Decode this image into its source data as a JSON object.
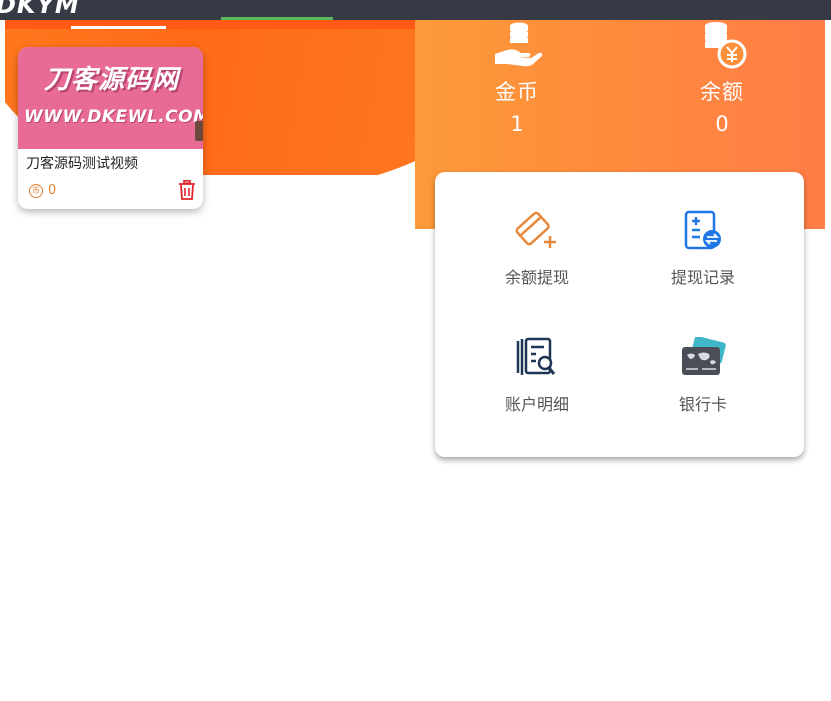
{
  "top_bar": {
    "logo_fragment": "DKYM"
  },
  "video_card": {
    "thumbnail_line1": "刀客源码网",
    "thumbnail_line2": "WWW.DKEWL.COM",
    "title": "刀客源码测试视频",
    "coin_symbol": "币",
    "coin_count": "0"
  },
  "wallet": {
    "gold": {
      "label": "金币",
      "value": "1",
      "icon": "coins-hand-icon"
    },
    "balance": {
      "label": "余额",
      "value": "0",
      "icon": "yuan-coins-icon"
    }
  },
  "actions": [
    {
      "label": "余额提现",
      "icon": "card-plus-icon"
    },
    {
      "label": "提现记录",
      "icon": "exchange-record-icon"
    },
    {
      "label": "账户明细",
      "icon": "document-search-icon"
    },
    {
      "label": "银行卡",
      "icon": "bank-card-icon"
    }
  ],
  "colors": {
    "orange": "#ff7a22",
    "action_orange": "#e8883a",
    "action_blue": "#1f77e6",
    "dark_navy": "#1f3556",
    "delete_red": "#e0222a"
  }
}
